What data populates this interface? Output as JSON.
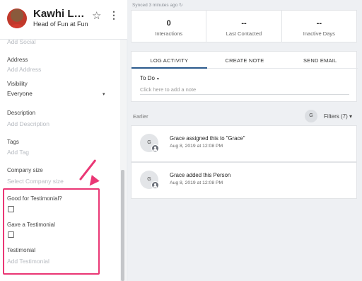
{
  "profile": {
    "name": "Kawhi Leon…",
    "title": "Head of Fun at Fun …",
    "star_icon": "☆",
    "menu_icon": "⋮"
  },
  "fields": {
    "social_placeholder": "Add Social",
    "address_label": "Address",
    "address_placeholder": "Add Address",
    "visibility_label": "Visibility",
    "visibility_value": "Everyone",
    "visibility_caret": "▾",
    "description_label": "Description",
    "description_placeholder": "Add Description",
    "tags_label": "Tags",
    "tags_placeholder": "Add Tag",
    "company_size_label": "Company size",
    "company_size_placeholder": "Select Company size",
    "good_for_testimonial_label": "Good for Testimonial?",
    "good_for_testimonial_checked": false,
    "gave_testimonial_label": "Gave a Testimonial",
    "gave_testimonial_checked": false,
    "testimonial_label": "Testimonial",
    "testimonial_placeholder": "Add Testimonial"
  },
  "synced": "Synced 3 minutes ago ↻",
  "stats": [
    {
      "value": "0",
      "label": "Interactions"
    },
    {
      "value": "--",
      "label": "Last Contacted"
    },
    {
      "value": "--",
      "label": "Inactive Days"
    }
  ],
  "composer": {
    "tabs": [
      {
        "label": "LOG ACTIVITY",
        "active": true
      },
      {
        "label": "CREATE NOTE",
        "active": false
      },
      {
        "label": "SEND EMAIL",
        "active": false
      }
    ],
    "type_value": "To Do",
    "type_caret": "▾",
    "note_placeholder": "Click here to add a note"
  },
  "feed": {
    "section_label": "Earlier",
    "filter_avatar": "G",
    "filters_label": "Filters (7) ▾",
    "items": [
      {
        "avatar": "G",
        "title": "Grace assigned this to \"Grace\"",
        "time": "Aug 8, 2019 at 12:08 PM"
      },
      {
        "avatar": "G",
        "title": "Grace added this Person",
        "time": "Aug 8, 2019 at 12:08 PM"
      }
    ]
  },
  "colors": {
    "highlight": "#ea3775",
    "active_tab": "#2a5a8c"
  }
}
